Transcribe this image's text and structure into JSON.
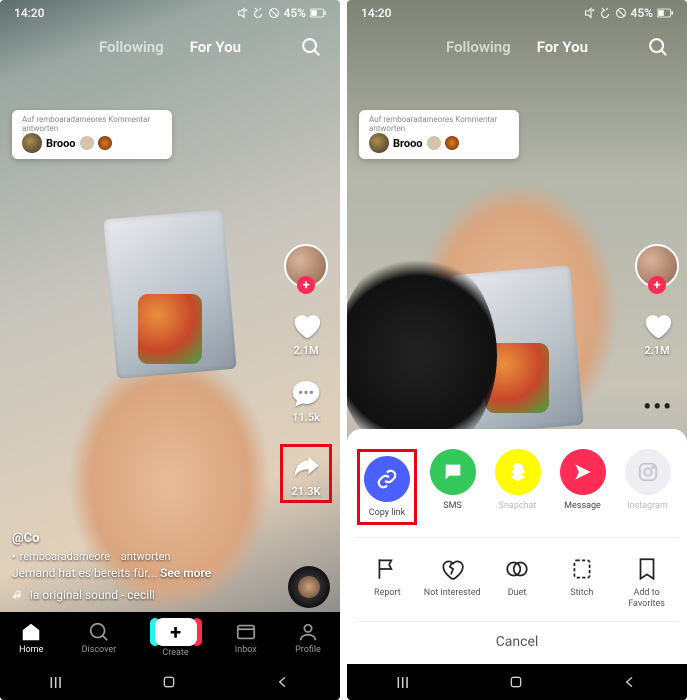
{
  "status": {
    "time": "14:20",
    "battery": "45%"
  },
  "tabs": {
    "following": "Following",
    "foryou": "For You"
  },
  "comment": {
    "header": "Auf remboaradameores Kommentar antworten",
    "name": "Brooo"
  },
  "rail": {
    "likes": "2.1M",
    "comments": "11.5k",
    "shares": "21.3K"
  },
  "caption": {
    "username": "@Co",
    "reply": "remboaradameore",
    "reply_suffix": "antworten",
    "line": "Jemand hat es bereits für...",
    "seemore": "See more",
    "sound": "ia   original sound - cecili"
  },
  "nav": {
    "home": "Home",
    "discover": "Discover",
    "create": "Create",
    "inbox": "Inbox",
    "profile": "Profile"
  },
  "share": {
    "copylink": "Copy link",
    "sms": "SMS",
    "snapchat": "Snapchat",
    "message": "Message",
    "instagram": "Instagram"
  },
  "actions": {
    "report": "Report",
    "not_interested": "Not interested",
    "duet": "Duet",
    "stitch": "Stitch",
    "favorite": "Add to Favorites"
  },
  "cancel": "Cancel"
}
